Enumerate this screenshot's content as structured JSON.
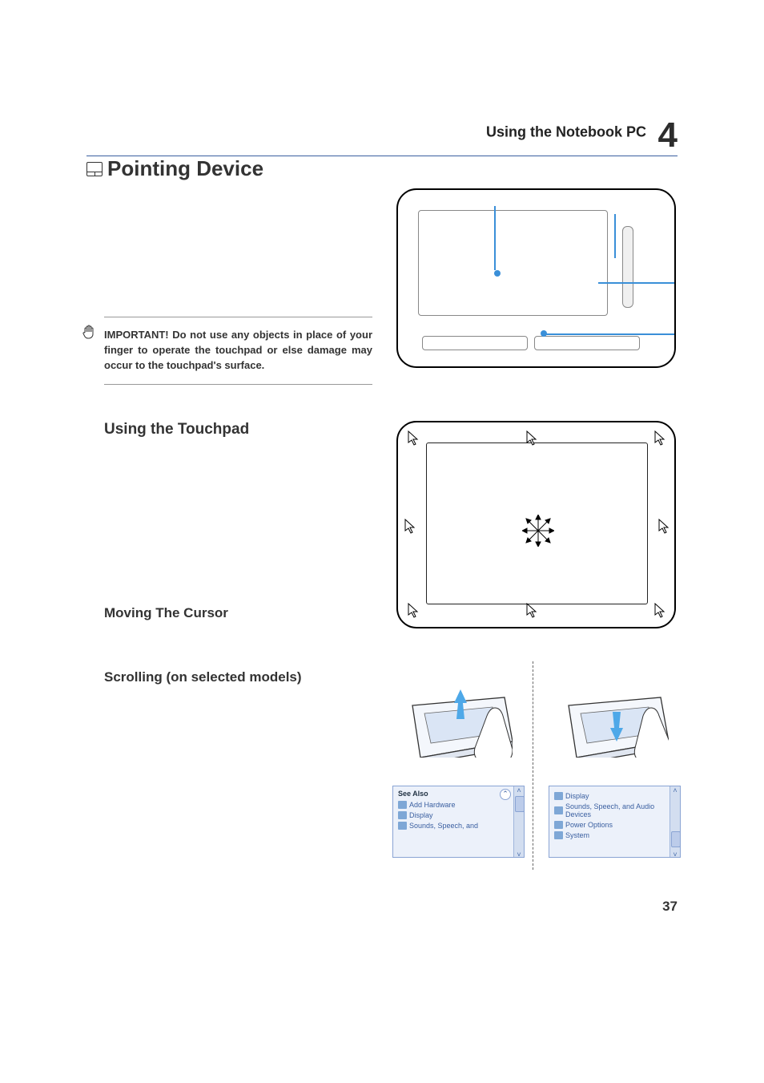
{
  "header": {
    "title": "Using the Notebook PC",
    "chapter": "4"
  },
  "section": {
    "title": "Pointing Device"
  },
  "important": {
    "text": "IMPORTANT! Do not use any objects in place of your finger to operate the touchpad or else damage may occur to the touchpad's surface."
  },
  "subheadings": {
    "using_touchpad": "Using the Touchpad",
    "moving_cursor": "Moving The Cursor",
    "scrolling": "Scrolling (on selected models)"
  },
  "panel_left": {
    "see_also": "See Also",
    "items": [
      "Add Hardware",
      "Display",
      "Sounds, Speech, and"
    ]
  },
  "panel_right": {
    "items": [
      "Display",
      "Sounds, Speech, and Audio Devices",
      "Power Options",
      "System"
    ]
  },
  "page_number": "37"
}
